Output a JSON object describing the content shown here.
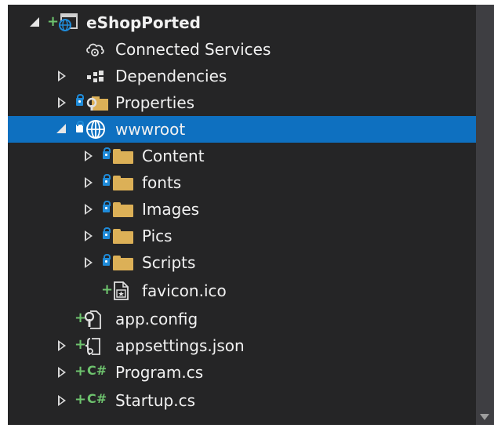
{
  "tree": {
    "project": {
      "name": "eShopPorted"
    },
    "items": {
      "connected_services": "Connected Services",
      "dependencies": "Dependencies",
      "properties": "Properties",
      "wwwroot": "wwwroot",
      "content": "Content",
      "fonts": "fonts",
      "images": "Images",
      "pics": "Pics",
      "scripts": "Scripts",
      "favicon": "favicon.ico",
      "app_config": "app.config",
      "appsettings": "appsettings.json",
      "program": "Program.cs",
      "startup": "Startup.cs"
    },
    "selected": "wwwroot"
  },
  "icons": {
    "project": "web-project-icon",
    "connected_services": "cloud-gear-icon",
    "dependencies": "dependencies-icon",
    "properties": "properties-folder-icon",
    "wwwroot": "globe-icon",
    "folder": "folder-icon",
    "favicon": "image-file-icon",
    "app_config": "config-file-icon",
    "appsettings": "json-file-icon",
    "csharp": "C#"
  },
  "colors": {
    "background": "#252526",
    "selection": "#0e70c0",
    "text": "#f1f1f1",
    "added_glyph": "#6ec36e",
    "lock": "#1f8bd9",
    "folder": "#dcb057"
  }
}
